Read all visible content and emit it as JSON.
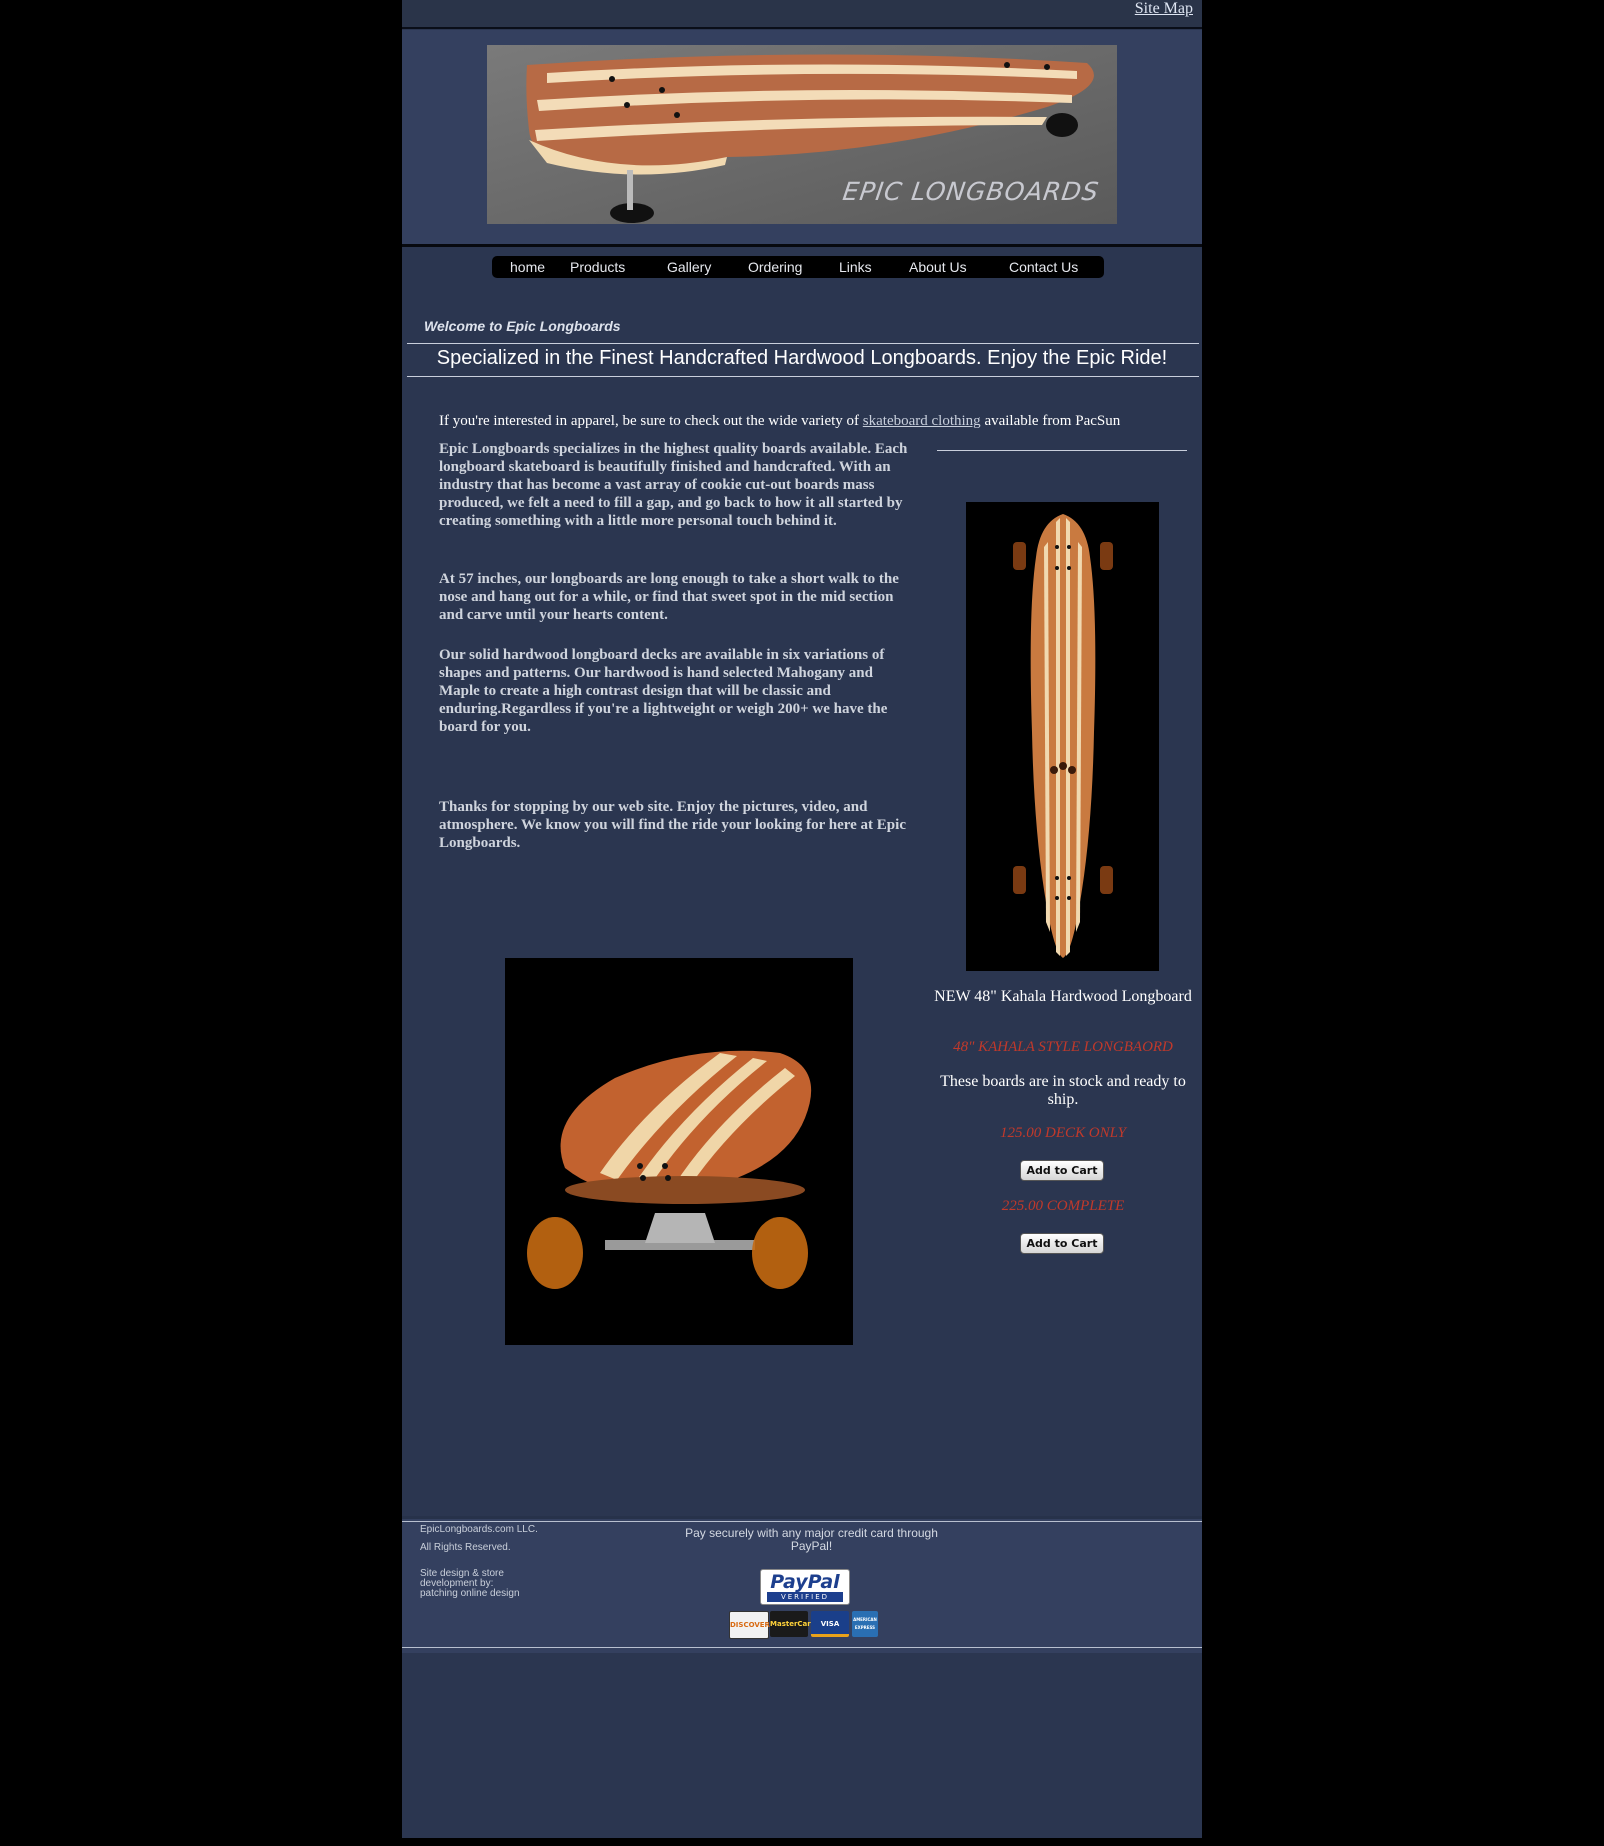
{
  "header": {
    "sitemap_label": "Site Map",
    "banner_caption": "EPIC LONGBOARDS"
  },
  "nav": {
    "items": [
      "home",
      "Products",
      "Gallery",
      "Ordering",
      "Links",
      "About Us",
      "Contact Us"
    ]
  },
  "main": {
    "welcome": "Welcome to Epic Longboards",
    "tagline": "Specialized in the Finest Handcrafted Hardwood Longboards. Enjoy the Epic Ride!",
    "apparel_prefix": "If you're interested in apparel, be sure to check out the wide variety of ",
    "apparel_link": "skateboard clothing",
    "apparel_suffix": " available from PacSun",
    "paragraphs": [
      "Epic Longboards specializes in the highest quality boards available. Each longboard skateboard is beautifully finished and handcrafted. With an industry that has become a vast array of cookie cut-out boards mass produced, we felt a need to fill a gap, and go back to how it all started by creating something with a little more personal touch behind it.",
      "At 57 inches, our longboards are long enough to take a short walk to the nose and hang out for a while, or find that sweet spot in the mid section and carve until your hearts content.",
      "Our solid hardwood longboard decks are available in six variations of shapes and patterns. Our hardwood is hand selected Mahogany and Maple to create a high contrast design that will be classic and enduring.Regardless if you're a lightweight or weigh 200+ we have the board for you.",
      "Thanks for stopping by our web site. Enjoy the pictures, video, and atmosphere. We know you will find the ride your looking for here at Epic Longboards."
    ]
  },
  "product": {
    "title": "NEW 48\" Kahala Hardwood Longboard",
    "style": "48\" KAHALA STYLE LONGBAORD",
    "stock": "These boards are in stock and ready to ship.",
    "price_deck": "125.00 DECK ONLY",
    "price_complete": "225.00 COMPLETE",
    "cart_label": "Add to Cart"
  },
  "footer": {
    "company": "EpicLongboards.com LLC.",
    "rights": "All Rights Reserved.",
    "design_line1": "Site design & store",
    "design_line2": "development by:",
    "designer": "patching online design",
    "pay_text": "Pay securely with any major credit card through PayPal!",
    "paypal_word": "PayPal",
    "paypal_verified": "VERIFIED",
    "cards": [
      "DISCOVER",
      "MasterCard",
      "VISA",
      "AMERICAN EXPRESS"
    ]
  },
  "colors": {
    "page_bg": "#2b3650",
    "accent_red": "#c0392b",
    "header_bg": "#34405f"
  }
}
